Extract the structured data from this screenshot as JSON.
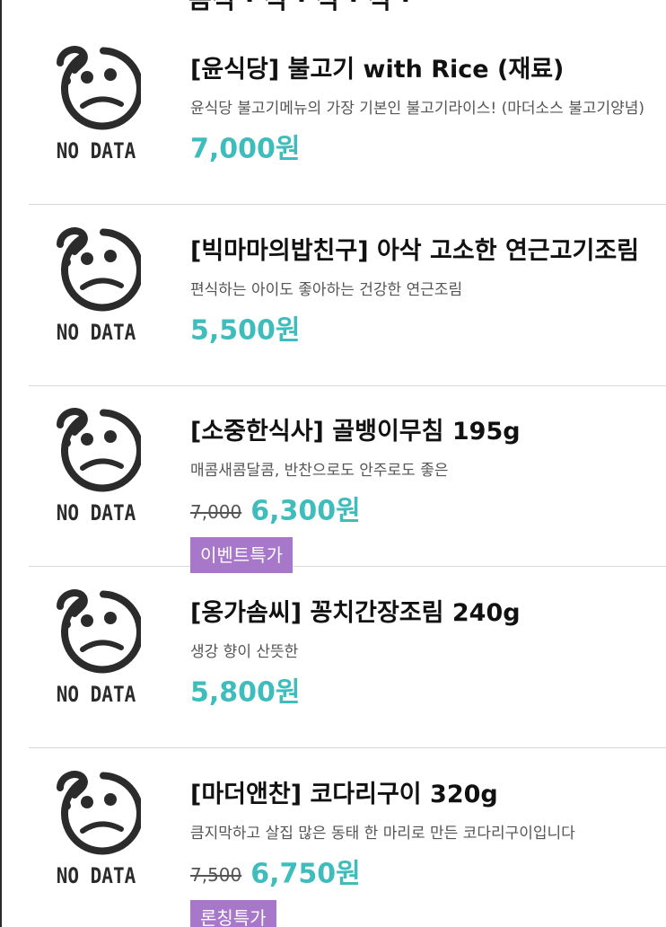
{
  "top_cut_text": "음식 · 식 · 식 · 식 ·",
  "placeholder": {
    "label": "NO DATA",
    "icon": "confused-face-icon"
  },
  "products": [
    {
      "title": "[윤식당] 불고기 with Rice (재료)",
      "description": "윤식당 불고기메뉴의 가장 기본인 불고기라이스! (마더소스 불고기양념)",
      "original_price": "",
      "price": "7,000원",
      "badge": ""
    },
    {
      "title": "[빅마마의밥친구] 아삭 고소한 연근고기조림",
      "description": "편식하는 아이도 좋아하는 건강한 연근조림",
      "original_price": "",
      "price": "5,500원",
      "badge": ""
    },
    {
      "title": "[소중한식사] 골뱅이무침 195g",
      "description": "매콤새콤달콤, 반찬으로도 안주로도 좋은",
      "original_price": "7,000",
      "price": "6,300원",
      "badge": "이벤트특가"
    },
    {
      "title": "[옹가솜씨] 꽁치간장조림 240g",
      "description": "생강 향이 산뜻한",
      "original_price": "",
      "price": "5,800원",
      "badge": ""
    },
    {
      "title": "[마더앤찬] 코다리구이 320g",
      "description": "큼지막하고 살집 많은 동태 한 마리로 만든 코다리구이입니다",
      "original_price": "7,500",
      "price": "6,750원",
      "badge": "론칭특가"
    }
  ],
  "colors": {
    "price": "#3fbcbc",
    "badge": "#a777c9",
    "divider": "#d8d8d8"
  }
}
